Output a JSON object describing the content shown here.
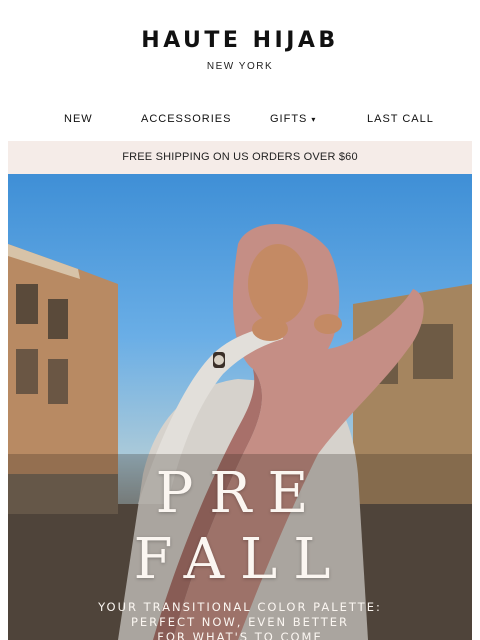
{
  "brand": {
    "name": "HAUTE HIJAB",
    "location": "NEW YORK"
  },
  "nav": {
    "items": [
      {
        "label": "NEW"
      },
      {
        "label": "ACCESSORIES"
      },
      {
        "label": "GIFTS",
        "icon": "chevron-down-icon"
      },
      {
        "label": "LAST CALL"
      }
    ]
  },
  "promo": {
    "shipping_text": "FREE SHIPPING ON US ORDERS OVER $60"
  },
  "hero": {
    "title_line1": "PRE",
    "title_line2": "FALL",
    "subtitle_line1": "YOUR TRANSITIONAL COLOR PALETTE:",
    "subtitle_line2": "PERFECT NOW, EVEN BETTER",
    "subtitle_line3": "FOR WHAT'S TO COME"
  },
  "colors": {
    "promo_bar": "#f5ece8",
    "sky": "#4a95d9",
    "hijab": "#c58e85",
    "text_dark": "#111111"
  }
}
